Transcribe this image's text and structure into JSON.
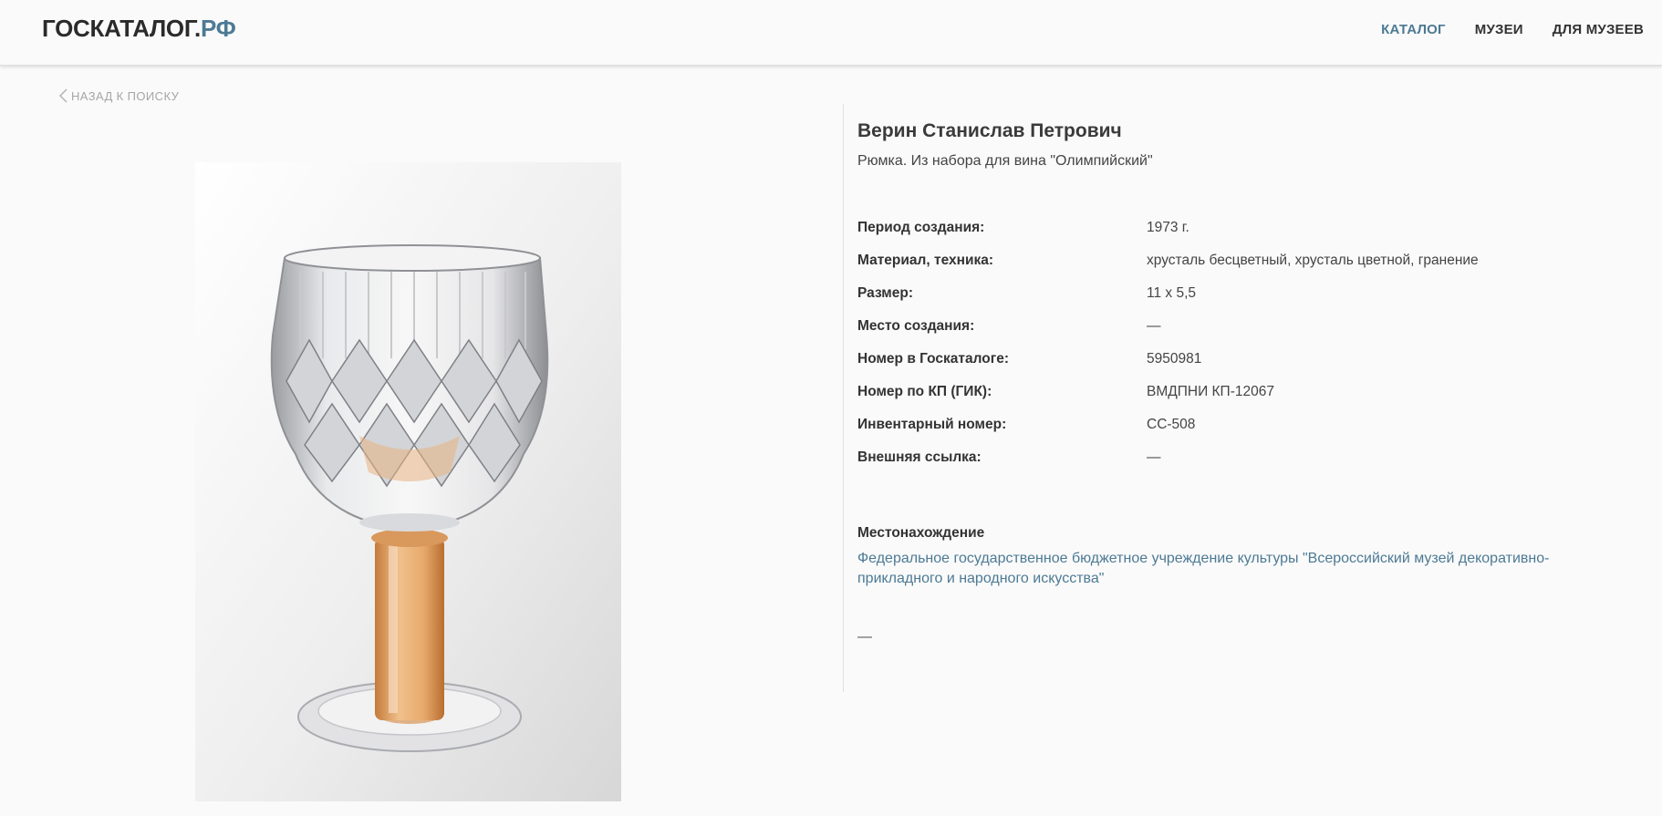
{
  "header": {
    "logo_main": "ГОСКАТАЛОГ.",
    "logo_suffix": "РФ",
    "nav": [
      {
        "label": "КАТАЛОГ",
        "active": true
      },
      {
        "label": "МУЗЕИ",
        "active": false
      },
      {
        "label": "ДЛЯ МУЗЕЕВ",
        "active": false
      }
    ]
  },
  "back_link": "НАЗАД К ПОИСКУ",
  "item": {
    "author": "Верин Станислав Петрович",
    "title": "Рюмка. Из набора для вина \"Олимпийский\"",
    "properties": [
      {
        "label": "Период создания:",
        "value": "1973 г."
      },
      {
        "label": "Материал, техника:",
        "value": "хрусталь бесцветный, хрусталь цветной, гранение"
      },
      {
        "label": "Размер:",
        "value": "11 x 5,5"
      },
      {
        "label": "Место создания:",
        "value": "—"
      },
      {
        "label": "Номер в Госкаталоге:",
        "value": "5950981"
      },
      {
        "label": "Номер по КП (ГИК):",
        "value": "ВМДПНИ КП-12067"
      },
      {
        "label": "Инвентарный номер:",
        "value": "СС-508"
      },
      {
        "label": "Внешняя ссылка:",
        "value": "—"
      }
    ],
    "location_heading": "Местонахождение",
    "location_link": "Федеральное государственное бюджетное учреждение культуры \"Всероссийский музей декоративно-прикладного и народного искусства\"",
    "bottom_dash": "—"
  },
  "colors": {
    "accent": "#4d7a94",
    "background": "#fafafa",
    "amber_glass": "#e3a66b"
  },
  "icons": {
    "back": "chevron-left-icon"
  }
}
